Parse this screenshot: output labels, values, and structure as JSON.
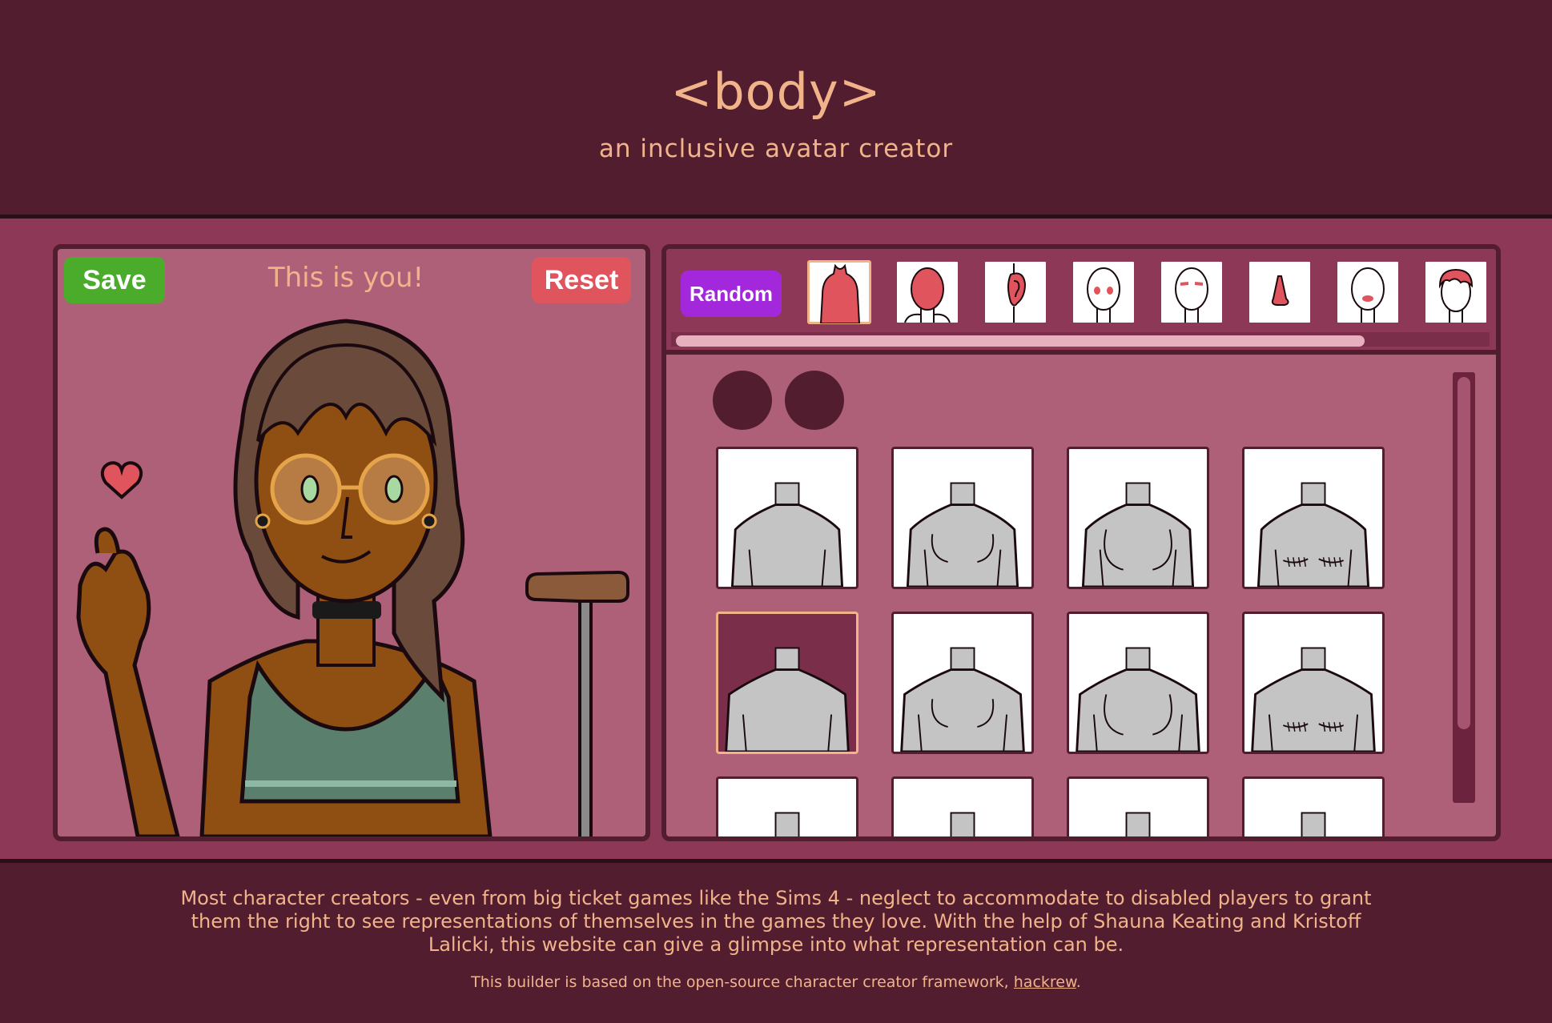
{
  "header": {
    "title": "<body>",
    "subtitle": "an inclusive avatar creator"
  },
  "avatar_panel": {
    "save_label": "Save",
    "reset_label": "Reset",
    "caption": "This is you!"
  },
  "options_panel": {
    "random_label": "Random",
    "categories": [
      {
        "name": "body",
        "icon": "body-silhouette-icon",
        "active": true
      },
      {
        "name": "head",
        "icon": "head-shape-icon"
      },
      {
        "name": "ears",
        "icon": "ear-icon"
      },
      {
        "name": "eyes",
        "icon": "eyes-icon"
      },
      {
        "name": "eyebrows",
        "icon": "eyebrows-icon"
      },
      {
        "name": "nose",
        "icon": "nose-icon"
      },
      {
        "name": "mouth",
        "icon": "mouth-icon"
      },
      {
        "name": "hair",
        "icon": "hair-icon"
      }
    ],
    "color_swatches": [
      "#521d2f",
      "#521d2f"
    ],
    "body_options": [
      {
        "type": "flat",
        "selected": false
      },
      {
        "type": "small-chest",
        "selected": false
      },
      {
        "type": "chest",
        "selected": false
      },
      {
        "type": "top-surgery-scars",
        "selected": false
      },
      {
        "type": "flat-wide",
        "selected": true
      },
      {
        "type": "small-chest-wide",
        "selected": false
      },
      {
        "type": "chest-wide",
        "selected": false
      },
      {
        "type": "top-surgery-scars-wide",
        "selected": false
      }
    ]
  },
  "footer": {
    "text": "Most character creators - even from big ticket games like the Sims 4 - neglect to accommodate to disabled players to grant them the right to see representations of themselves in the games they love. With the help of Shauna Keating and Kristoff Lalicki, this website can give a glimpse into what representation can be.",
    "credit_prefix": "This builder is based on the open-source character creator framework,",
    "credit_link": "hackrew",
    "credit_suffix": "."
  },
  "colors": {
    "background": "#521d2f",
    "panel": "#ad6077",
    "accent_text": "#f1b48a",
    "save": "#4bab2b",
    "reset": "#e0555d",
    "random": "#a328db"
  }
}
